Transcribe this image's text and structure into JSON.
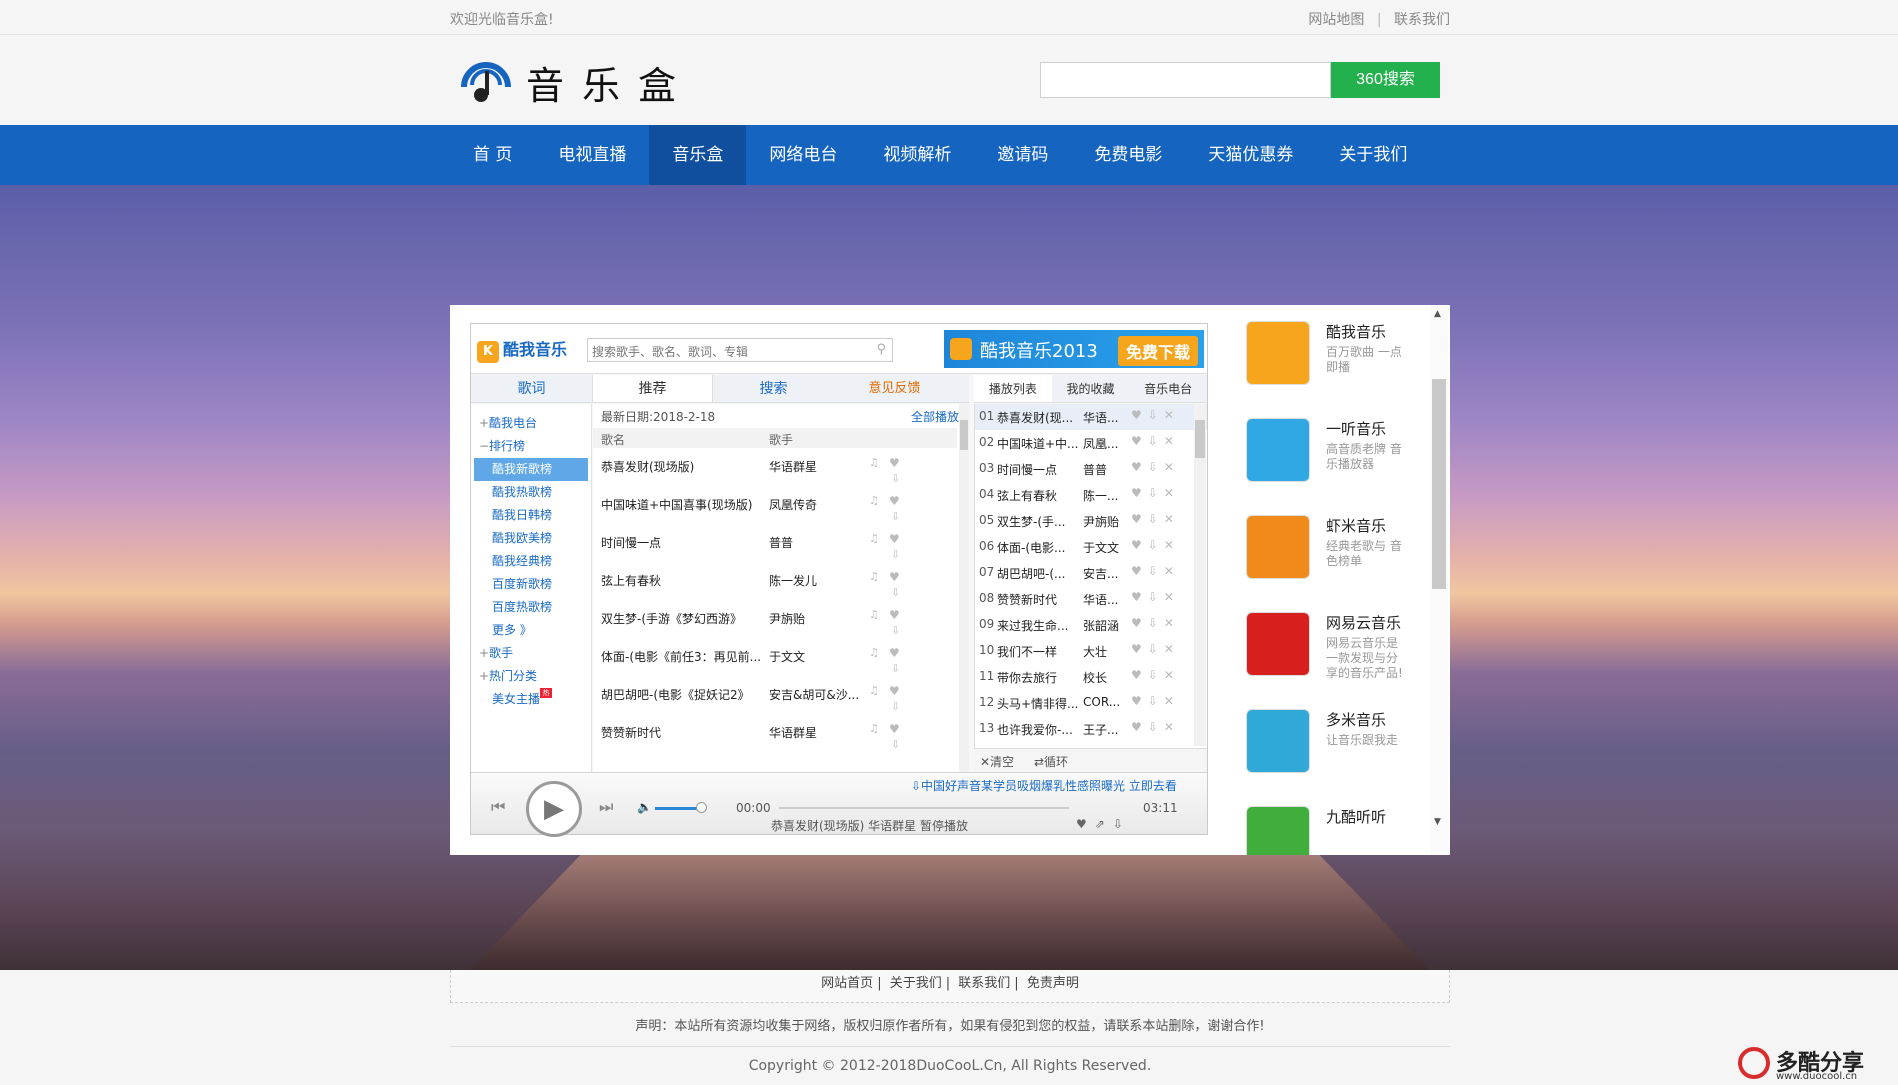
{
  "topbar": {
    "welcome": "欢迎光临音乐盒!",
    "sitemap": "网站地图",
    "sep": "|",
    "contact": "联系我们"
  },
  "header": {
    "logo_text": "音乐盒",
    "search_placeholder": "",
    "search_button": "360搜索"
  },
  "nav": [
    "首 页",
    "电视直播",
    "音乐盒",
    "网络电台",
    "视频解析",
    "邀请码",
    "免费电影",
    "天猫优惠券",
    "关于我们"
  ],
  "player": {
    "logo": "酷我音乐",
    "search_placeholder": "搜索歌手、歌名、歌词、专辑",
    "banner": "酷我音乐2013",
    "banner_button": "免费下载",
    "tabs": [
      "歌词",
      "推荐",
      "搜索",
      "意见反馈"
    ],
    "sidebar": {
      "radio": "酷我电台",
      "charts": "排行榜",
      "chart_items": [
        "酷我新歌榜",
        "酷我热歌榜",
        "酷我日韩榜",
        "酷我欧美榜",
        "酷我经典榜",
        "百度新歌榜",
        "百度热歌榜"
      ],
      "more": "更多 》",
      "singer": "歌手",
      "hot": "热门分类",
      "girls": "美女主播",
      "hot_badge": "热"
    },
    "list": {
      "date": "最新日期:2018-2-18",
      "play_all": "全部播放",
      "col_name": "歌名",
      "col_singer": "歌手",
      "rows": [
        {
          "name": "恭喜发财(现场版)",
          "singer": "华语群星"
        },
        {
          "name": "中国味道+中国喜事(现场版)",
          "singer": "凤凰传奇"
        },
        {
          "name": "时间慢一点",
          "singer": "普普"
        },
        {
          "name": "弦上有春秋",
          "singer": "陈一发儿"
        },
        {
          "name": "双生梦-(手游《梦幻西游》",
          "singer": "尹旃贻"
        },
        {
          "name": "体面-(电影《前任3：再见前...",
          "singer": "于文文"
        },
        {
          "name": "胡巴胡吧-(电影《捉妖记2》",
          "singer": "安吉&胡可&沙..."
        },
        {
          "name": "赞赞新时代",
          "singer": "华语群星"
        }
      ]
    },
    "queue_tabs": [
      "播放列表",
      "我的收藏",
      "音乐电台"
    ],
    "queue": [
      {
        "i": "01",
        "t": "恭喜发财(现...",
        "a": "华语..."
      },
      {
        "i": "02",
        "t": "中国味道+中...",
        "a": "凤凰..."
      },
      {
        "i": "03",
        "t": "时间慢一点",
        "a": "普普"
      },
      {
        "i": "04",
        "t": "弦上有春秋",
        "a": "陈一..."
      },
      {
        "i": "05",
        "t": "双生梦-(手...",
        "a": "尹旃贻"
      },
      {
        "i": "06",
        "t": "体面-(电影...",
        "a": "于文文"
      },
      {
        "i": "07",
        "t": "胡巴胡吧-(...",
        "a": "安吉..."
      },
      {
        "i": "08",
        "t": "赞赞新时代",
        "a": "华语..."
      },
      {
        "i": "09",
        "t": "来过我生命...",
        "a": "张韶涵"
      },
      {
        "i": "10",
        "t": "我们不一样",
        "a": "大壮"
      },
      {
        "i": "11",
        "t": "带你去旅行",
        "a": "校长"
      },
      {
        "i": "12",
        "t": "头马+情非得...",
        "a": "COR..."
      },
      {
        "i": "13",
        "t": "也许我爱你-...",
        "a": "王子..."
      }
    ],
    "queue_clear": "✕清空",
    "queue_loop": "⇄循环",
    "ad": "⇩中国好声音某学员吸烟爆乳性感照曝光 立即去看",
    "time_current": "00:00",
    "time_total": "03:11",
    "volume_level": 0.85,
    "progress": 0,
    "now_playing": "恭喜发财(现场版) 华语群星 暂停播放"
  },
  "apps": [
    {
      "name": "酷我音乐",
      "desc": "百万歌曲 一点即播",
      "color": "#f7a51c"
    },
    {
      "name": "一听音乐",
      "desc": "高音质老牌 音乐播放器",
      "color": "#2fa8e3"
    },
    {
      "name": "虾米音乐",
      "desc": "经典老歌与 音色榜单",
      "color": "#f08a1a"
    },
    {
      "name": "网易云音乐",
      "desc": "网易云音乐是 一款发现与分 享的音乐产品!",
      "color": "#d7201e"
    },
    {
      "name": "多米音乐",
      "desc": "让音乐跟我走",
      "color": "#31a9d8"
    },
    {
      "name": "九酷听听",
      "desc": "",
      "color": "#3fae3b"
    }
  ],
  "footer": {
    "links": [
      "网站首页",
      "关于我们",
      "联系我们",
      "免责声明"
    ],
    "note": "声明：本站所有资源均收集于网络，版权归原作者所有，如果有侵犯到您的权益，请联系本站删除，谢谢合作!",
    "copyright": "Copyright © 2012-2018DuoCooL.Cn, All Rights Reserved."
  },
  "watermark": {
    "title": "多酷分享",
    "url": "www.duocool.cn"
  }
}
